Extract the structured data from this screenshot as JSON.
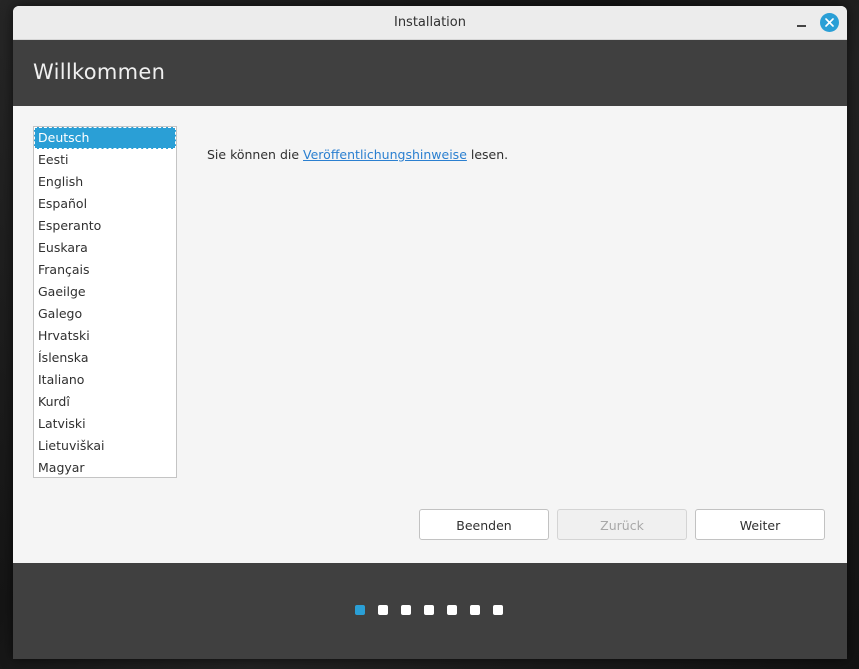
{
  "window": {
    "title": "Installation"
  },
  "header": {
    "heading": "Willkommen"
  },
  "languages": {
    "selected_index": 0,
    "items": [
      "Deutsch",
      "Eesti",
      "English",
      "Español",
      "Esperanto",
      "Euskara",
      "Français",
      "Gaeilge",
      "Galego",
      "Hrvatski",
      "Íslenska",
      "Italiano",
      "Kurdî",
      "Latviski",
      "Lietuviškai",
      "Magyar"
    ]
  },
  "release_notes": {
    "prefix": "Sie können die",
    "link": "Veröffentlichungshinweise",
    "suffix": "lesen."
  },
  "buttons": {
    "quit": "Beenden",
    "back": "Zurück",
    "next": "Weiter"
  },
  "progress": {
    "total_steps": 7,
    "current_step": 1
  },
  "colors": {
    "accent": "#2a9fd6",
    "header_bg": "#404040",
    "content_bg": "#f5f5f5"
  },
  "icons": {
    "minimize": "minimize-icon",
    "close": "close-icon"
  }
}
